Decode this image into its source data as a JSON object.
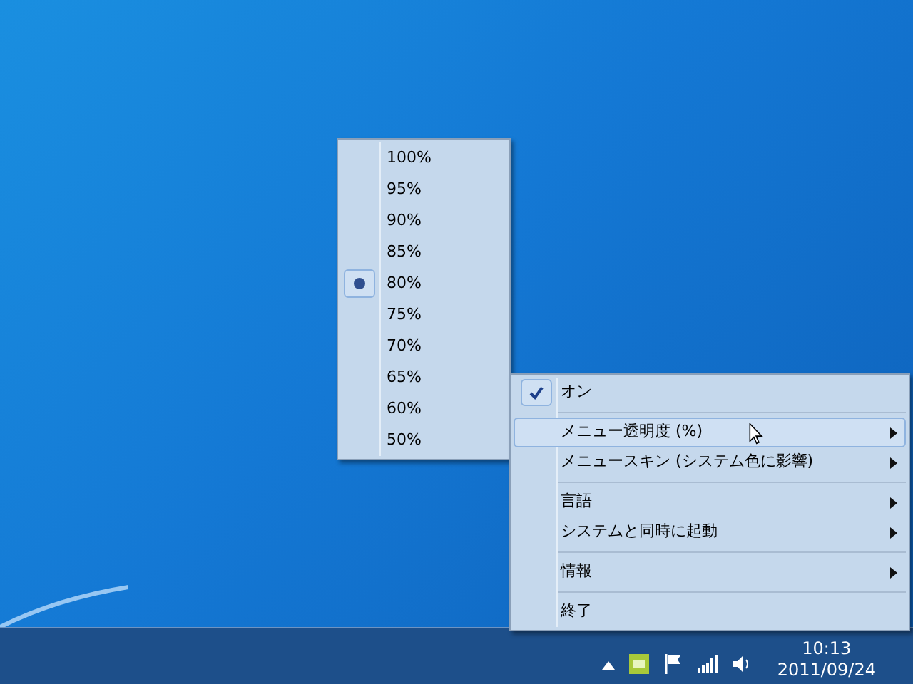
{
  "submenu": {
    "items": [
      {
        "label": "100%",
        "selected": false
      },
      {
        "label": "95%",
        "selected": false
      },
      {
        "label": "90%",
        "selected": false
      },
      {
        "label": "85%",
        "selected": false
      },
      {
        "label": "80%",
        "selected": true
      },
      {
        "label": "75%",
        "selected": false
      },
      {
        "label": "70%",
        "selected": false
      },
      {
        "label": "65%",
        "selected": false
      },
      {
        "label": "60%",
        "selected": false
      },
      {
        "label": "50%",
        "selected": false
      }
    ]
  },
  "menu": {
    "items": [
      {
        "kind": "check",
        "label": "オン",
        "checked": true,
        "highlighted": false
      },
      {
        "kind": "separator"
      },
      {
        "kind": "submenu",
        "label": "メニュー透明度 (%)",
        "highlighted": true
      },
      {
        "kind": "submenu",
        "label": "メニュースキン (システム色に影響)",
        "highlighted": false
      },
      {
        "kind": "separator"
      },
      {
        "kind": "submenu",
        "label": "言語",
        "highlighted": false
      },
      {
        "kind": "submenu",
        "label": "システムと同時に起動",
        "highlighted": false
      },
      {
        "kind": "separator"
      },
      {
        "kind": "submenu",
        "label": "情報",
        "highlighted": false
      },
      {
        "kind": "separator"
      },
      {
        "kind": "plain",
        "label": "終了",
        "highlighted": false
      }
    ]
  },
  "taskbar": {
    "clock": {
      "time": "10:13",
      "date": "2011/09/24"
    }
  }
}
